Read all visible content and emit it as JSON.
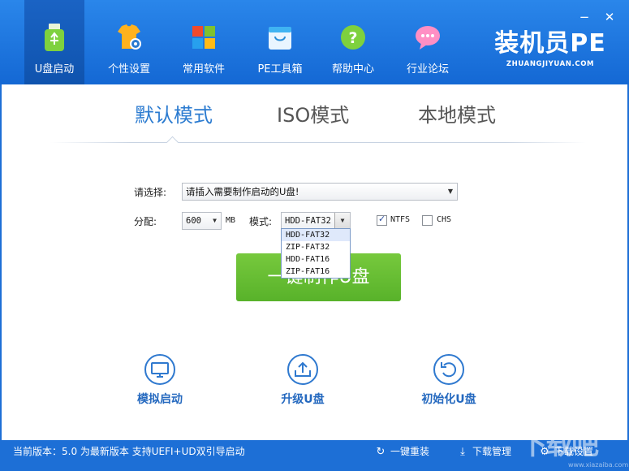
{
  "window": {
    "minimize": "−",
    "close": "✕"
  },
  "nav": {
    "items": [
      {
        "label": "U盘启动",
        "icon": "usb-drive-icon",
        "active": true
      },
      {
        "label": "个性设置",
        "icon": "tshirt-gear-icon"
      },
      {
        "label": "常用软件",
        "icon": "tiles-icon"
      },
      {
        "label": "PE工具箱",
        "icon": "toolbox-bag-icon"
      },
      {
        "label": "帮助中心",
        "icon": "help-icon"
      },
      {
        "label": "行业论坛",
        "icon": "chat-bubble-icon"
      }
    ]
  },
  "brand": {
    "name": "装机员PE",
    "url": "ZHUANGJIYUAN.COM"
  },
  "tabs": [
    {
      "label": "默认模式",
      "active": true
    },
    {
      "label": "ISO模式"
    },
    {
      "label": "本地模式"
    }
  ],
  "form": {
    "select_label": "请选择:",
    "drive_value": "请插入需要制作启动的U盘!",
    "alloc_label": "分配:",
    "alloc_value": "600",
    "alloc_unit": "MB",
    "mode_label": "模式:",
    "mode_value": "HDD-FAT32",
    "ntfs_label": "NTFS",
    "ntfs_checked": true,
    "chs_label": "CHS",
    "chs_checked": false
  },
  "dropdown": {
    "options": [
      "HDD-FAT32",
      "ZIP-FAT32",
      "HDD-FAT16",
      "ZIP-FAT16"
    ],
    "selected": "HDD-FAT32"
  },
  "make_button": "一键制作U盘",
  "actions": [
    {
      "label": "模拟启动",
      "icon": "monitor-icon"
    },
    {
      "label": "升级U盘",
      "icon": "upload-tray-icon"
    },
    {
      "label": "初始化U盘",
      "icon": "reset-arrow-icon"
    }
  ],
  "footer": {
    "version_text": "当前版本：5.0 为最新版本 支持UEFI+UD双引导启动",
    "reinstall": "一键重装",
    "download_mgr": "下载管理",
    "download_set": "下载设置"
  },
  "watermark": {
    "text": "下载吧",
    "url": "www.xiazaiba.com"
  },
  "colors": {
    "header": "#1f78e0",
    "accent": "#2b7bd0",
    "green": "#62bb30",
    "footer": "#1d6fd6"
  }
}
